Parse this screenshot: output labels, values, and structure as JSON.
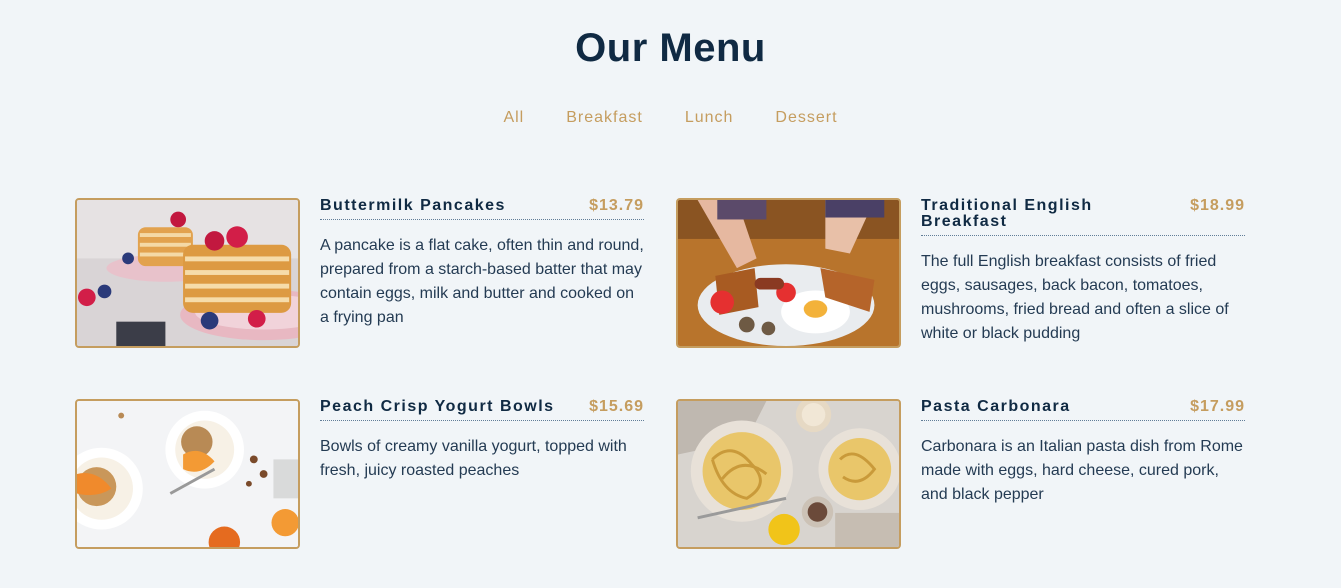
{
  "page_title": "Our Menu",
  "filters": [
    "All",
    "Breakfast",
    "Lunch",
    "Dessert"
  ],
  "items": [
    {
      "name": "Buttermilk Pancakes",
      "price": "$13.79",
      "desc": "A pancake is a flat cake, often thin and round, prepared from a starch-based batter that may contain eggs, milk and butter and cooked on a frying pan"
    },
    {
      "name": "Traditional English Breakfast",
      "price": "$18.99",
      "desc": "The full English breakfast consists of fried eggs, sausages, back bacon, tomatoes, mushrooms, fried bread and often a slice of white or black pudding"
    },
    {
      "name": "Peach Crisp Yogurt Bowls",
      "price": "$15.69",
      "desc": "Bowls of creamy vanilla yogurt, topped with fresh, juicy roasted peaches"
    },
    {
      "name": "Pasta Carbonara",
      "price": "$17.99",
      "desc": "Carbonara is an Italian pasta dish from Rome made with eggs, hard cheese, cured pork, and black pepper"
    }
  ],
  "colors": {
    "accent": "#c59d5f",
    "heading": "#102a43",
    "background": "#f1f5f8"
  }
}
